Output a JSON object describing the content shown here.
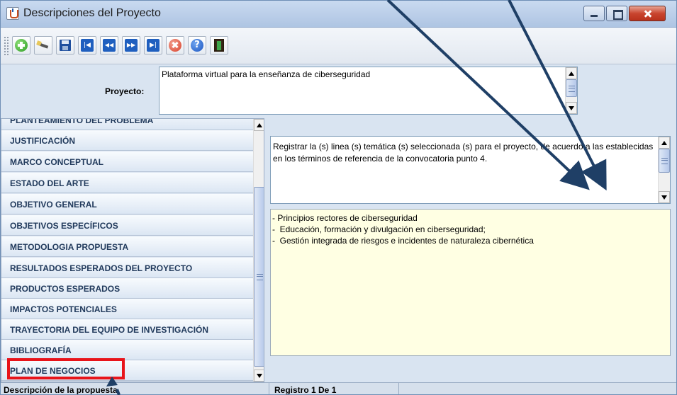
{
  "window": {
    "title": "Descripciones del Proyecto"
  },
  "toolbar": {
    "buttons": [
      "add-icon",
      "edit-icon",
      "save-icon",
      "first-icon",
      "previous-icon",
      "next-icon",
      "last-icon",
      "delete-icon",
      "help-icon",
      "exit-icon"
    ]
  },
  "project": {
    "label": "Proyecto:",
    "value": "Plataforma virtual para la enseñanza de ciberseguridad"
  },
  "sections": {
    "partial_item": "PLANTEAMIENTO DEL PROBLEMA",
    "items": [
      "JUSTIFICACIÓN",
      "MARCO CONCEPTUAL",
      "ESTADO DEL ARTE",
      "OBJETIVO GENERAL",
      "OBJETIVOS ESPECÍFICOS",
      "METODOLOGIA PROPUESTA",
      "RESULTADOS ESPERADOS DEL PROYECTO",
      "PRODUCTOS ESPERADOS",
      "IMPACTOS POTENCIALES",
      "TRAYECTORIA DEL EQUIPO DE INVESTIGACIÓN",
      "BIBLIOGRAFÍA",
      "PLAN DE NEGOCIOS"
    ]
  },
  "description": {
    "text": "Registrar la (s) linea (s) temática (s) seleccionada (s) para el proyecto, de acuerdo a las establecidas en los términos de referencia de la convocatoria punto 4."
  },
  "content": {
    "lines": [
      "- Principios rectores de ciberseguridad",
      "-  Educación, formación y divulgación en ciberseguridad;",
      "-  Gestión integrada de riesgos e incidentes de naturaleza cibernética"
    ]
  },
  "status": {
    "left": "Descripción de la propuesta",
    "right": "Registro 1 De 1"
  },
  "colors": {
    "highlight": "#e8141a",
    "arrow": "#1f3f66",
    "content_background": "#ffffe3"
  }
}
